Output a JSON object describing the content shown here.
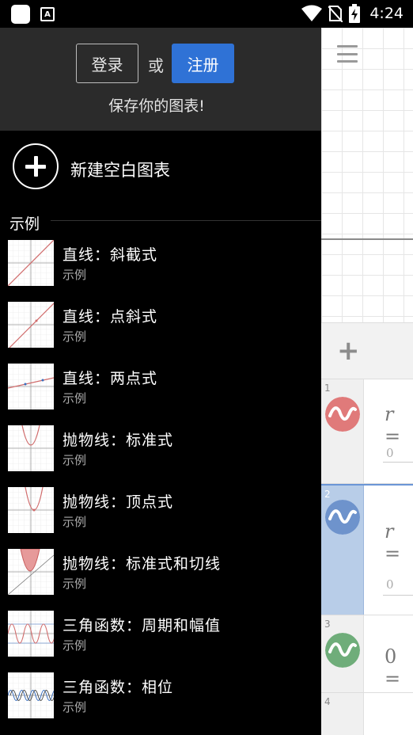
{
  "status_bar": {
    "time": "4:24",
    "icons": [
      "app-icon",
      "text-icon",
      "wifi-icon",
      "no-sim-icon",
      "battery-charging-icon"
    ]
  },
  "drawer": {
    "login_label": "登录",
    "or_label": "或",
    "signup_label": "注册",
    "save_prompt": "保存你的图表!",
    "new_graph_label": "新建空白图表",
    "section_title": "示例",
    "examples": [
      {
        "title": "直线：斜截式",
        "subtitle": "示例"
      },
      {
        "title": "直线：点斜式",
        "subtitle": "示例"
      },
      {
        "title": "直线：两点式",
        "subtitle": "示例"
      },
      {
        "title": "抛物线：标准式",
        "subtitle": "示例"
      },
      {
        "title": "抛物线：顶点式",
        "subtitle": "示例"
      },
      {
        "title": "抛物线：标准式和切线",
        "subtitle": "示例"
      },
      {
        "title": "三角函数：周期和幅值",
        "subtitle": "示例"
      },
      {
        "title": "三角函数：相位",
        "subtitle": "示例"
      }
    ]
  },
  "expressions": [
    {
      "number": "1",
      "formula": "r =",
      "value": "0",
      "color": "#e07a7a"
    },
    {
      "number": "2",
      "formula": "r =",
      "value": "0",
      "color": "#6e93cc"
    },
    {
      "number": "3",
      "formula": "0 =",
      "value": "",
      "color": "#6fad7a"
    },
    {
      "number": "4",
      "formula": "",
      "value": "",
      "color": ""
    }
  ],
  "colors": {
    "accent": "#2f72d6",
    "header_bg": "#2b2b2b",
    "drawer_bg": "#000000"
  }
}
